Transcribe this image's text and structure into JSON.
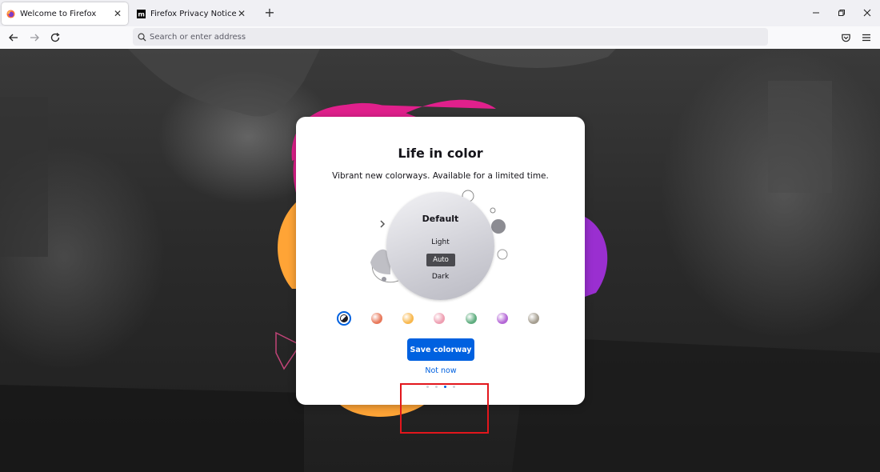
{
  "tabs": [
    {
      "title": "Welcome to Firefox",
      "active": true,
      "favicon": "firefox-icon"
    },
    {
      "title": "Firefox Privacy Notice — Mozilla",
      "active": false,
      "favicon": "mozilla-icon"
    }
  ],
  "nav": {
    "url_placeholder": "Search or enter address"
  },
  "modal": {
    "title": "Life in color",
    "subtitle": "Vibrant new colorways. Available for a limited time.",
    "variant_title": "Default",
    "variant_options": [
      "Light",
      "Auto",
      "Dark"
    ],
    "selected_variant": "Auto",
    "swatches": [
      {
        "name": "default",
        "color": "#ffffff",
        "selected": true
      },
      {
        "name": "orange",
        "color": "#e8785a",
        "selected": false
      },
      {
        "name": "yellow",
        "color": "#f8b84e",
        "selected": false
      },
      {
        "name": "pink",
        "color": "#ee9fb2",
        "selected": false
      },
      {
        "name": "green",
        "color": "#5fad7f",
        "selected": false
      },
      {
        "name": "purple",
        "color": "#b467d6",
        "selected": false
      },
      {
        "name": "gray",
        "color": "#a59e90",
        "selected": false
      }
    ],
    "primary_button": "Save colorway",
    "secondary_link": "Not now",
    "step_count": 4,
    "active_step": 3
  },
  "colors": {
    "accent": "#0061e0",
    "highlight": "#e2161c",
    "blob_pink": "#e0208c",
    "blob_orange": "#ffa436",
    "blob_purple": "#9a2fd0"
  }
}
